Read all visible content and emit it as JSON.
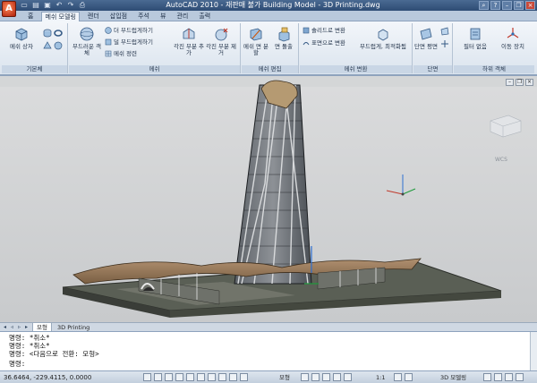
{
  "app_button_label": "A",
  "window": {
    "title": "AutoCAD 2010 - 재판매 불가   Building Model - 3D Printing.dwg"
  },
  "quick_access": [
    "new-icon",
    "open-icon",
    "save-icon",
    "undo-icon",
    "redo-icon",
    "print-icon"
  ],
  "ribbon_tabs": [
    {
      "label": "홈"
    },
    {
      "label": "메쉬 모델링",
      "active": true
    },
    {
      "label": "렌더"
    },
    {
      "label": "삽입점"
    },
    {
      "label": "주석"
    },
    {
      "label": "뷰"
    },
    {
      "label": "관리"
    },
    {
      "label": "출력"
    }
  ],
  "panels": {
    "basic": {
      "title": "기본체",
      "mesh_box": "메쉬 상자"
    },
    "mesh": {
      "title": "메쉬",
      "smooth_object": "부드러운 객체",
      "smooth_more": "더 부드럽게하기",
      "smooth_less": "덜 부드럽게하기",
      "refine_mesh": "메쉬 정련",
      "add_crease": "각진 부분 추가",
      "remove_crease": "각진 부분 제거"
    },
    "mesh_edit": {
      "title": "메쉬 편집",
      "split_face": "메쉬 면 분할",
      "extrude_face": "면 돌출"
    },
    "mesh_convert": {
      "title": "메쉬 변환",
      "to_solid": "솔리드로 변환",
      "to_surface": "표면으로 변환",
      "smooth_optimized": "부드럽게, 최적화됨"
    },
    "section": {
      "title": "단면",
      "section_plane": "단면 평면"
    },
    "subobject": {
      "title": "하위 객체",
      "filter": "필터 없음",
      "move_gizmo": "이동 장치"
    }
  },
  "viewport": {
    "wcs_label": "WCS"
  },
  "layout_tabs": [
    {
      "label": "모형",
      "active": true
    },
    {
      "label": "3D Printing"
    }
  ],
  "command_lines": [
    "명령: *취소*",
    "명령: *취소*",
    "명령:  <다음으로 전환: 모형>",
    "명령:"
  ],
  "status": {
    "coords": "36.6464,  -229.4115, 0.0000",
    "model": "모형",
    "scale": "1:1",
    "workspace": "3D 모델링"
  }
}
